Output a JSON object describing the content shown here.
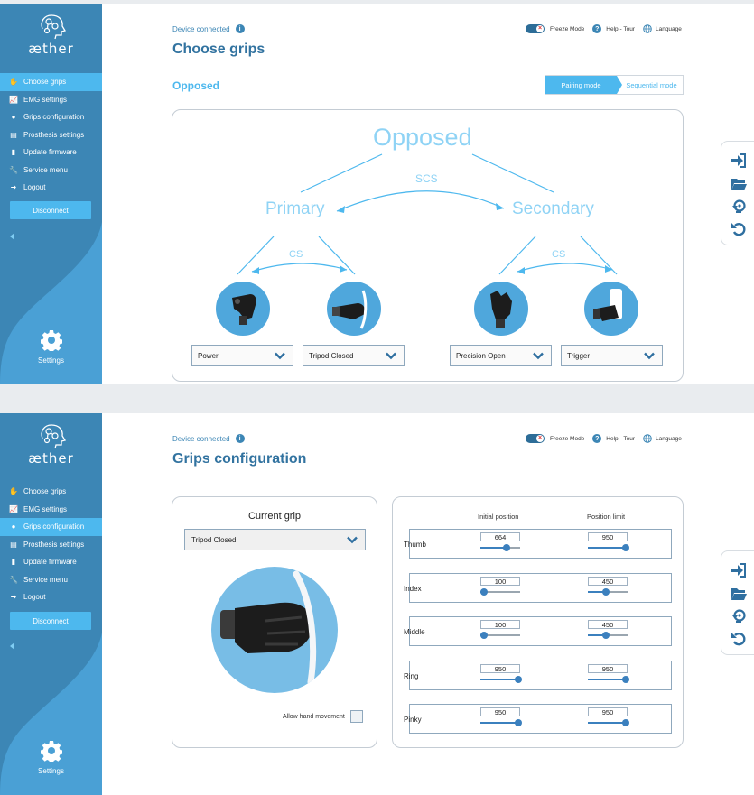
{
  "brand": {
    "name": "æther"
  },
  "nav": {
    "items": [
      {
        "label": "Choose grips",
        "icon": "hand-icon"
      },
      {
        "label": "EMG settings",
        "icon": "chart-icon"
      },
      {
        "label": "Grips configuration",
        "icon": "grip-icon"
      },
      {
        "label": "Prosthesis settings",
        "icon": "clipboard-icon"
      },
      {
        "label": "Update firmware",
        "icon": "database-icon"
      },
      {
        "label": "Service menu",
        "icon": "wrench-icon"
      },
      {
        "label": "Logout",
        "icon": "logout-icon"
      }
    ],
    "disconnect_label": "Disconnect",
    "settings_label": "Settings"
  },
  "header": {
    "status": "Device connected",
    "freeze_mode": "Freeze Mode",
    "help": "Help - Tour",
    "language": "Language"
  },
  "screen1": {
    "title": "Choose grips",
    "active_nav": "Choose grips",
    "section": "Opposed",
    "mode_active": "Pairing mode",
    "mode_inactive": "Sequential mode",
    "tree": {
      "root": "Opposed",
      "scs": "SCS",
      "primary": "Primary",
      "secondary": "Secondary",
      "cs_left": "CS",
      "cs_right": "CS"
    },
    "grips": [
      {
        "selected": "Power"
      },
      {
        "selected": "Tripod Closed"
      },
      {
        "selected": "Precision Open"
      },
      {
        "selected": "Trigger"
      }
    ]
  },
  "screen2": {
    "title": "Grips configuration",
    "active_nav": "Grips configuration",
    "current_grip_title": "Current grip",
    "current_grip": "Tripod Closed",
    "allow_label": "Allow hand movement",
    "allow_checked": false,
    "col_initial": "Initial position",
    "col_limit": "Position limit",
    "slider_max": 1000,
    "fingers": [
      {
        "name": "Thumb",
        "initial": "664",
        "limit": "950"
      },
      {
        "name": "Index",
        "initial": "100",
        "limit": "450"
      },
      {
        "name": "Middle",
        "initial": "100",
        "limit": "450"
      },
      {
        "name": "Ring",
        "initial": "950",
        "limit": "950"
      },
      {
        "name": "Pinky",
        "initial": "950",
        "limit": "950"
      }
    ]
  },
  "side_tools": [
    "import-icon",
    "folder-open-icon",
    "restore-icon",
    "undo-icon"
  ],
  "colors": {
    "sidebar": "#3c86b5",
    "accent": "#4db8ee",
    "title": "#3273a0",
    "tree_text": "#8fd3f5",
    "hand_bg": "#4fa7dc",
    "slider": "#3b80be"
  }
}
